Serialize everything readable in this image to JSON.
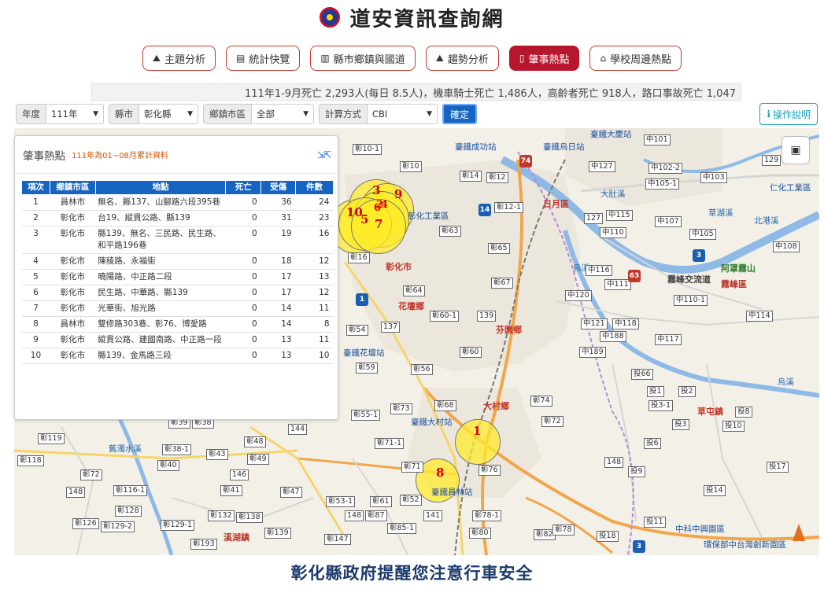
{
  "header": {
    "title": "道安資訊查詢網",
    "logo_icon": "emblem-icon"
  },
  "nav": [
    {
      "label": "主題分析",
      "icon": "chart-icon",
      "active": false
    },
    {
      "label": "統計快覽",
      "icon": "newspaper-icon",
      "active": false
    },
    {
      "label": "縣市鄉鎮與國道",
      "icon": "bar-chart-icon",
      "active": false
    },
    {
      "label": "趨勢分析",
      "icon": "area-chart-icon",
      "active": false
    },
    {
      "label": "肇事熱點",
      "icon": "map-icon",
      "active": true
    },
    {
      "label": "學校周邊熱點",
      "icon": "school-icon",
      "active": false
    }
  ],
  "stats_line": "111年1-9月死亡 2,293人(每日 8.5人)，機車騎士死亡 1,486人，高齡者死亡 918人，路口事故死亡 1,047",
  "filters": {
    "year": {
      "label": "年度",
      "value": "111年"
    },
    "county": {
      "label": "縣市",
      "value": "彰化縣"
    },
    "town": {
      "label": "鄉鎮市區",
      "value": "全部"
    },
    "method": {
      "label": "計算方式",
      "value": "CBI"
    },
    "confirm_label": "確定"
  },
  "help_label": "操作說明",
  "panel": {
    "title": "肇事熱點",
    "note": "111年為01~08月累計資料",
    "columns": [
      "項次",
      "鄉鎮市區",
      "地點",
      "死亡",
      "受傷",
      "件數"
    ],
    "rows": [
      {
        "rank": "1",
        "district": "員林市",
        "location": "無名、縣137、山腳路六段395巷",
        "deaths": "0",
        "injuries": "36",
        "cases": "24"
      },
      {
        "rank": "2",
        "district": "彰化市",
        "location": "台19、縱貫公路、縣139",
        "deaths": "0",
        "injuries": "31",
        "cases": "23"
      },
      {
        "rank": "3",
        "district": "彰化市",
        "location": "縣139、無名、三民路、民生路、和平路196巷",
        "deaths": "0",
        "injuries": "19",
        "cases": "16"
      },
      {
        "rank": "4",
        "district": "彰化市",
        "location": "陳稜路、永福街",
        "deaths": "0",
        "injuries": "18",
        "cases": "12"
      },
      {
        "rank": "5",
        "district": "彰化市",
        "location": "曉陽路、中正路二段",
        "deaths": "0",
        "injuries": "17",
        "cases": "13"
      },
      {
        "rank": "6",
        "district": "彰化市",
        "location": "民生路、中華路、縣139",
        "deaths": "0",
        "injuries": "17",
        "cases": "12"
      },
      {
        "rank": "7",
        "district": "彰化市",
        "location": "光華街、旭光路",
        "deaths": "0",
        "injuries": "14",
        "cases": "11"
      },
      {
        "rank": "8",
        "district": "員林市",
        "location": "雙修路303巷、彰76、博愛路",
        "deaths": "0",
        "injuries": "14",
        "cases": "8"
      },
      {
        "rank": "9",
        "district": "彰化市",
        "location": "縱貫公路、建國南路、中正路一段",
        "deaths": "0",
        "injuries": "13",
        "cases": "11"
      },
      {
        "rank": "10",
        "district": "彰化市",
        "location": "縣139、金馬路三段",
        "deaths": "0",
        "injuries": "13",
        "cases": "10"
      }
    ]
  },
  "map": {
    "place_labels": [
      "彰化市",
      "花壇鄉",
      "芬園鄉",
      "大村鄉",
      "日月區",
      "霧峰區",
      "草屯鎮",
      "溪湖鎮",
      "阿罩霧山",
      "霧峰交流道"
    ],
    "station_labels": [
      "臺鐵成功站",
      "臺鐵烏日站",
      "臺鐵大慶站",
      "臺鐵花壇站",
      "臺鐵大村站",
      "臺鐵員林站",
      "中科中興園區",
      "彰化工業區",
      "仁化工業區",
      "環保部中台灣創新園區"
    ],
    "river_labels": [
      "大肚溪",
      "烏溪",
      "草湖溪",
      "北港溪",
      "舊濁水溪",
      "烏溪"
    ],
    "road_labels": [
      "彰10-1",
      "彰10",
      "彰14",
      "彰12",
      "彰12-1",
      "彰63",
      "彰65",
      "彰16",
      "彰64",
      "彰67",
      "彰60-1",
      "139",
      "彰54",
      "137",
      "彰60",
      "彰59",
      "彰56",
      "彰73",
      "彰68",
      "彰55-1",
      "彰71-1",
      "彰72",
      "彰74",
      "彰71",
      "彰76",
      "彰61",
      "彰52",
      "彰53-1",
      "141",
      "彰78-1",
      "彰85-1",
      "彰80",
      "彰82",
      "彰78",
      "彰147",
      "148",
      "彰87",
      "彰119",
      "彰118",
      "彰72",
      "彰116-1",
      "148",
      "彰128",
      "彰126",
      "彰129-2",
      "彰129-1",
      "彰132",
      "彰138",
      "彰139",
      "彰193",
      "彰38-1",
      "彰40",
      "彰43",
      "彰49",
      "146",
      "彰41",
      "彰47",
      "彰48",
      "144",
      "彰39",
      "彰38",
      "中101",
      "中127",
      "中102-2",
      "中103",
      "中105-1",
      "129",
      "中115",
      "中110",
      "中107",
      "中105",
      "中108",
      "中116",
      "中111",
      "中120",
      "中110-1",
      "中121",
      "中118",
      "中188",
      "中117",
      "中114",
      "中189",
      "投66",
      "投1",
      "投2",
      "投3-1",
      "投8",
      "投10",
      "投3",
      "投6",
      "148",
      "投9",
      "投17",
      "投14",
      "投11",
      "投18",
      "127"
    ],
    "hotspots": [
      {
        "n": "1"
      },
      {
        "n": "2"
      },
      {
        "n": "3"
      },
      {
        "n": "4"
      },
      {
        "n": "5"
      },
      {
        "n": "6"
      },
      {
        "n": "7"
      },
      {
        "n": "8"
      },
      {
        "n": "9"
      },
      {
        "n": "10"
      }
    ],
    "layer_icon": "image-icon",
    "north_icon": "north-arrow-icon"
  },
  "footer": "彰化縣政府提醒您注意行車安全"
}
